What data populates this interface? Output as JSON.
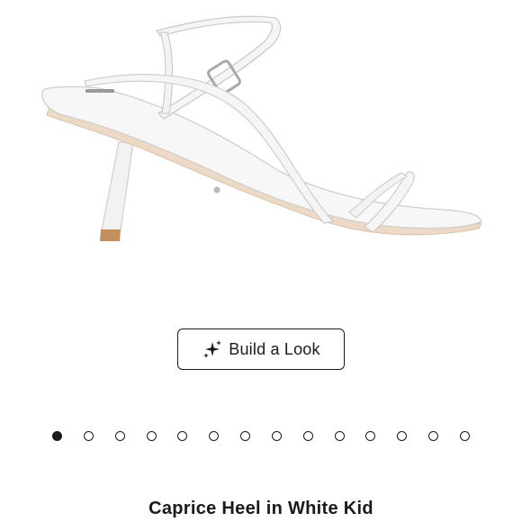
{
  "build_look": {
    "label": "Build a Look",
    "icon": "sparkle-icon"
  },
  "carousel": {
    "total": 14,
    "active_index": 0
  },
  "product": {
    "title": "Caprice Heel in White Kid"
  },
  "colors": {
    "text": "#1a1a1a",
    "shoe_white": "#f7f7f7",
    "shoe_outline": "#cfcfcf",
    "heel_tip": "#c48f5e",
    "sole_edge": "#e2c6ad"
  }
}
